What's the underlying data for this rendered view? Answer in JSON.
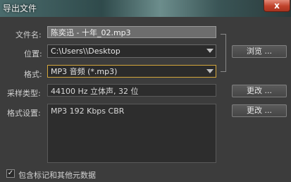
{
  "window": {
    "title": "导出文件",
    "close_glyph": "x"
  },
  "filename": {
    "label": "文件名:",
    "value": "陈奕迅 - 十年_02.mp3"
  },
  "location": {
    "label": "位置:",
    "value": "C:\\Users\\\\Desktop",
    "browse_label": "浏览 ..."
  },
  "format": {
    "label": "格式:",
    "value": "MP3 音频 (*.mp3)"
  },
  "sample_type": {
    "label": "采样类型:",
    "value": "44100 Hz 立体声, 32 位",
    "change_label": "更改 ..."
  },
  "format_settings": {
    "label": "格式设置:",
    "value": "MP3 192 Kbps CBR",
    "change_label": "更改 ..."
  },
  "metadata_checkbox": {
    "label": "包含标记和其他元数据",
    "checked": true,
    "check_glyph": "✓"
  }
}
